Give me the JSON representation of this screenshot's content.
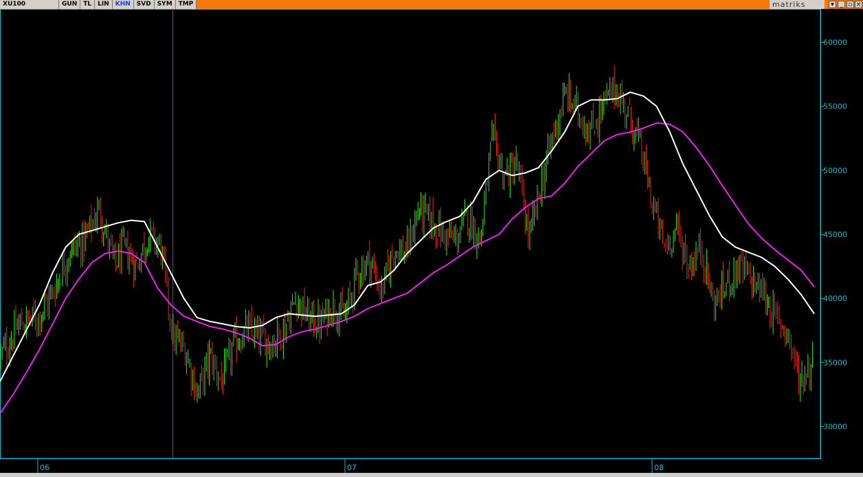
{
  "toolbar": {
    "symbol": "XU100",
    "buttons": [
      "GUN",
      "TL",
      "LIN",
      "KHN",
      "SVD",
      "SYM",
      "TMP"
    ],
    "active_button": "KHN",
    "brand": "matriks",
    "window_controls": [
      "▾",
      "_",
      "▫",
      "×"
    ]
  },
  "chart_data": {
    "type": "line",
    "subtype": "candlestick-with-moving-averages",
    "title": "",
    "xlabel": "",
    "ylabel": "",
    "ylim": [
      27500,
      62500
    ],
    "y_ticks": [
      30000,
      35000,
      40000,
      45000,
      50000,
      55000,
      60000
    ],
    "y_tick_labels": [
      "30000",
      "35000",
      "40000",
      "45000",
      "50000",
      "55000",
      "60000"
    ],
    "x_ticks": [
      "06",
      "07",
      "08"
    ],
    "x_tick_positions": [
      0.0,
      1.0,
      2.0
    ],
    "grid": false,
    "colors": {
      "up": "#22ee22",
      "down": "#ee2222",
      "ma_fast": "#ffffff",
      "ma_slow": "#ee22ee",
      "axis": "#22b5c8",
      "cursor": "#aa22cc"
    },
    "cursor_x": 0.44,
    "price_series": {
      "x": [
        -0.12,
        -0.06,
        0.0,
        0.05,
        0.1,
        0.15,
        0.2,
        0.25,
        0.28,
        0.32,
        0.36,
        0.4,
        0.44,
        0.48,
        0.52,
        0.56,
        0.6,
        0.64,
        0.68,
        0.72,
        0.76,
        0.8,
        0.84,
        0.88,
        0.92,
        0.96,
        1.0,
        1.04,
        1.08,
        1.12,
        1.16,
        1.2,
        1.24,
        1.28,
        1.32,
        1.36,
        1.4,
        1.44,
        1.48,
        1.52,
        1.56,
        1.6,
        1.64,
        1.68,
        1.72,
        1.76,
        1.8,
        1.84,
        1.88,
        1.92,
        1.96,
        2.0,
        2.04,
        2.08,
        2.12,
        2.16,
        2.2,
        2.24,
        2.28,
        2.32,
        2.36,
        2.4,
        2.44,
        2.48,
        2.52
      ],
      "y": [
        35500,
        38000,
        38500,
        40500,
        43500,
        44500,
        47000,
        42500,
        44000,
        42500,
        45000,
        44000,
        37000,
        36000,
        32500,
        35500,
        33500,
        36500,
        37500,
        37000,
        36500,
        37500,
        40000,
        38500,
        38000,
        39500,
        38500,
        42000,
        43000,
        40500,
        44000,
        43500,
        47000,
        46000,
        45000,
        44500,
        46500,
        44500,
        52500,
        49500,
        50500,
        44500,
        49000,
        53000,
        56000,
        54500,
        53000,
        55000,
        56500,
        54500,
        52000,
        47500,
        44000,
        45500,
        42500,
        44000,
        39500,
        41000,
        42500,
        41500,
        40500,
        38500,
        37500,
        33500,
        35000
      ]
    },
    "series": [
      {
        "values": [
          33500,
          35500,
          37500,
          39500,
          42000,
          44000,
          45000,
          45300,
          45600,
          45900,
          46100,
          46000,
          44000,
          42000,
          40000,
          38500,
          38200,
          38000,
          37800,
          37700,
          37900,
          38500,
          38800,
          38700,
          38600,
          38700,
          38800,
          39500,
          41000,
          41300,
          42200,
          43500,
          44500,
          45500,
          46000,
          46400,
          47500,
          49300,
          50000,
          49600,
          49800,
          50200,
          51500,
          53000,
          55000,
          55500,
          55500,
          55600,
          56100,
          55800,
          55000,
          53000,
          50500,
          48500,
          46500,
          44800,
          44000,
          43600,
          43200,
          42500,
          41500,
          40300,
          38800
        ]
      },
      {
        "values": [
          31000,
          32500,
          34200,
          36000,
          38000,
          40000,
          41500,
          42800,
          43500,
          43700,
          43500,
          42800,
          40800,
          39500,
          38600,
          38200,
          37800,
          37600,
          37300,
          36900,
          36300,
          36400,
          37000,
          37400,
          37600,
          37900,
          38200,
          38600,
          39200,
          39600,
          40000,
          40400,
          41200,
          42000,
          42600,
          43300,
          44000,
          44500,
          45000,
          46200,
          47100,
          47800,
          48000,
          49000,
          50300,
          51300,
          52300,
          52800,
          53000,
          53300,
          53700,
          53600,
          53000,
          51800,
          50400,
          48800,
          47300,
          45800,
          44700,
          43800,
          43000,
          42200,
          40900
        ]
      }
    ]
  }
}
